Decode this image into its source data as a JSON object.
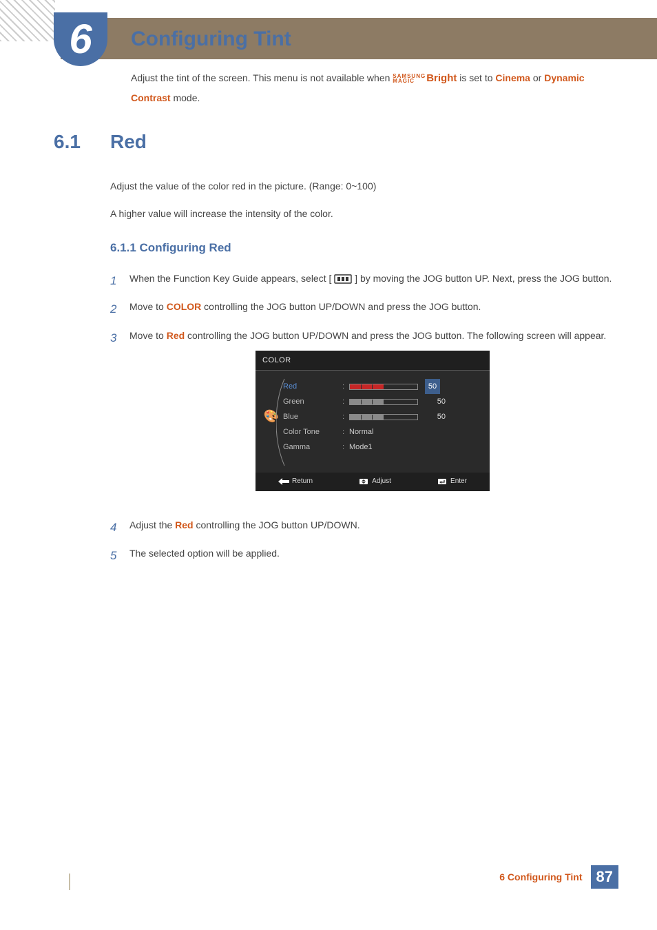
{
  "chapter": {
    "number": "6",
    "title": "Configuring Tint"
  },
  "intro": {
    "prefix": "Adjust the tint of the screen. This menu is not available when ",
    "magic_top": "SAMSUNG",
    "magic_bottom": "MAGIC",
    "bright": "Bright",
    "mid1": " is set to ",
    "cinema": "Cinema",
    "mid2": " or ",
    "dynamic": "Dynamic Contrast",
    "suffix": " mode."
  },
  "section": {
    "num": "6.1",
    "title": "Red"
  },
  "paras": {
    "p1": "Adjust the value of the color red in the picture. (Range: 0~100)",
    "p2": "A higher value will increase the intensity of the color."
  },
  "subsection": "6.1.1   Configuring Red",
  "steps": {
    "s1n": "1",
    "s1a": "When the Function Key Guide appears, select  [",
    "s1b": "]  by moving the JOG button UP. Next, press the JOG button.",
    "s2n": "2",
    "s2a": "Move to ",
    "s2color": "COLOR",
    "s2b": " controlling the JOG button UP/DOWN and press the JOG button.",
    "s3n": "3",
    "s3a": "Move to ",
    "s3red": "Red",
    "s3b": " controlling the JOG button UP/DOWN and press the JOG button. The following screen will appear.",
    "s4n": "4",
    "s4a": "Adjust the ",
    "s4red": "Red",
    "s4b": " controlling the JOG button UP/DOWN.",
    "s5n": "5",
    "s5": "The selected option will be applied."
  },
  "osd": {
    "title": "COLOR",
    "items": {
      "red": "Red",
      "green": "Green",
      "blue": "Blue",
      "tone": "Color Tone",
      "gamma": "Gamma"
    },
    "values": {
      "red": "50",
      "green": "50",
      "blue": "50",
      "tone": "Normal",
      "gamma": "Mode1"
    },
    "footer": {
      "return": "Return",
      "adjust": "Adjust",
      "enter": "Enter"
    }
  },
  "footer": {
    "chapter": "6 Configuring Tint",
    "page": "87"
  }
}
